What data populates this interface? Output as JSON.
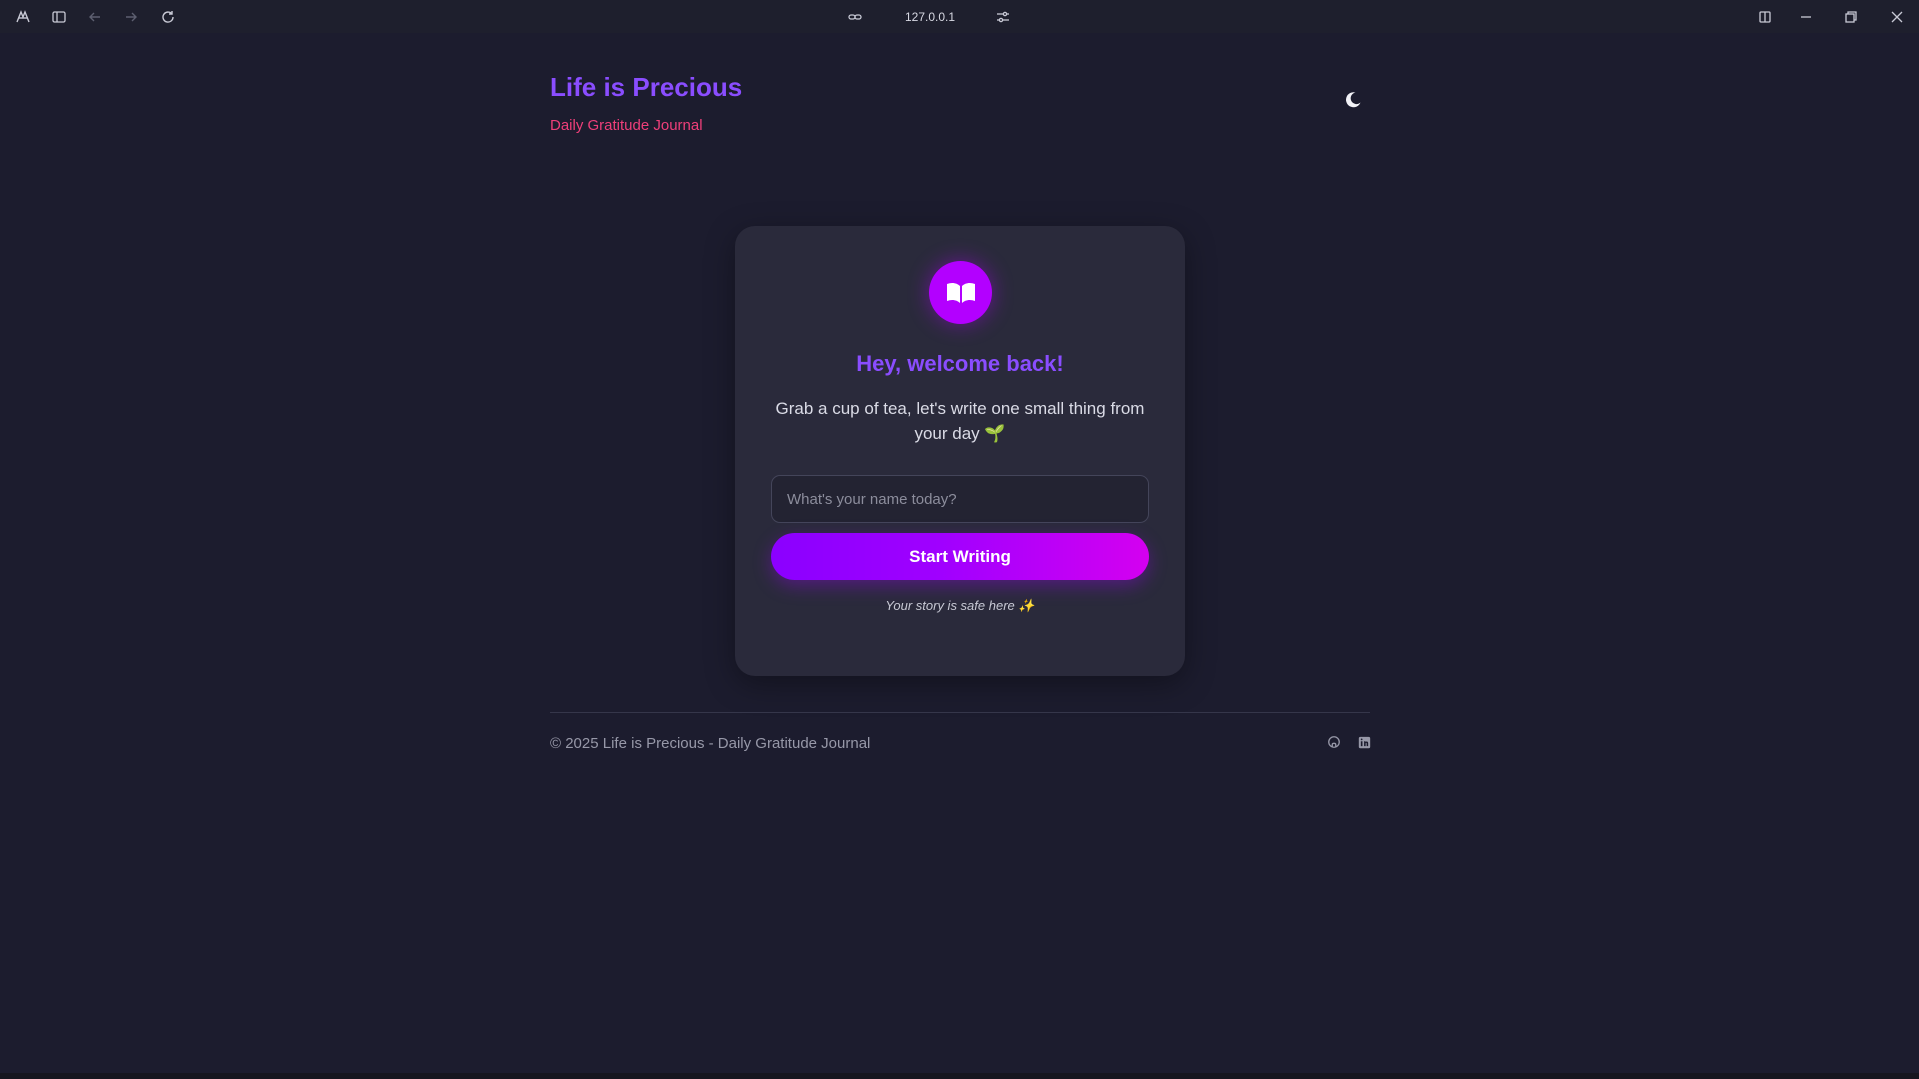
{
  "browser": {
    "url": "127.0.0.1",
    "icons": [
      "browser-logo-icon",
      "sidebar-toggle-icon",
      "back-arrow-icon",
      "forward-arrow-icon",
      "reload-icon",
      "link-icon",
      "tune-icon",
      "split-view-icon",
      "minimize-icon",
      "restore-icon",
      "close-icon"
    ]
  },
  "header": {
    "title": "Life is Precious",
    "subtitle": "Daily Gratitude Journal",
    "theme_icon": "moon-icon"
  },
  "card": {
    "icon": "open-book-icon",
    "title": "Hey, welcome back!",
    "text": "Grab a cup of tea, let's write one small thing from your day 🌱",
    "input_placeholder": "What's your name today?",
    "input_value": "",
    "button_label": "Start Writing",
    "note": "Your story is safe here ✨"
  },
  "footer": {
    "copyright": "© 2025 Life is Precious - Daily Gratitude Journal",
    "icons": [
      "github-icon",
      "linkedin-icon"
    ]
  },
  "colors": {
    "background": "#1c1c2e",
    "card": "#2a2a3b",
    "accent_purple": "#8a4dff",
    "accent_pink": "#ef3f7a",
    "button_gradient_start": "#8b00ff",
    "button_gradient_end": "#d400f0"
  }
}
